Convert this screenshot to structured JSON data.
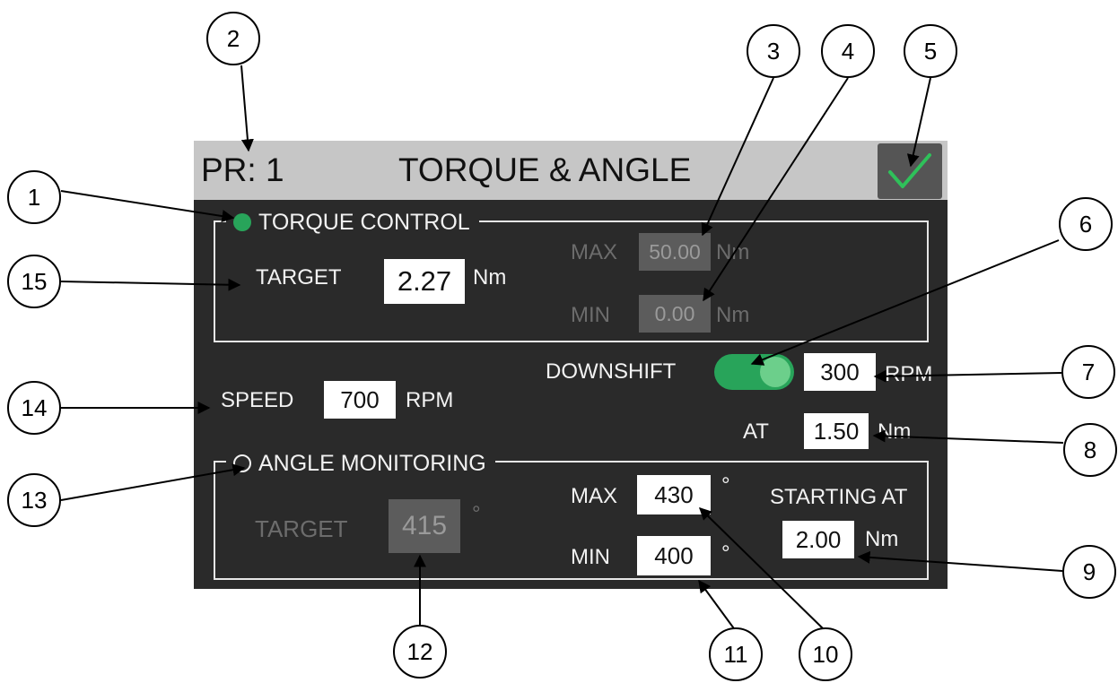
{
  "header": {
    "program_label": "PR: 1",
    "mode_title": "TORQUE & ANGLE"
  },
  "colors": {
    "panel_bg": "#2a2a2a",
    "title_bg": "#c6c6c6",
    "accent_green": "#28a45a",
    "disabled_field": "#5c5c5c"
  },
  "torque_control": {
    "label": "TORQUE CONTROL",
    "target_label": "TARGET",
    "target_value": "2.27",
    "target_unit": "Nm",
    "max_label": "MAX",
    "max_value": "50.00",
    "max_unit": "Nm",
    "min_label": "MIN",
    "min_value": "0.00",
    "min_unit": "Nm"
  },
  "speed": {
    "label": "SPEED",
    "value": "700",
    "unit": "RPM"
  },
  "downshift": {
    "label": "DOWNSHIFT",
    "enabled": true,
    "speed_value": "300",
    "speed_unit": "RPM",
    "at_label": "AT",
    "at_value": "1.50",
    "at_unit": "Nm"
  },
  "angle_monitoring": {
    "label": "ANGLE MONITORING",
    "target_label": "TARGET",
    "target_value": "415",
    "target_unit": "°",
    "max_label": "MAX",
    "max_value": "430",
    "max_unit": "°",
    "min_label": "MIN",
    "min_value": "400",
    "min_unit": "°",
    "starting_at_label": "STARTING AT",
    "starting_at_value": "2.00",
    "starting_at_unit": "Nm"
  },
  "callouts": [
    "1",
    "2",
    "3",
    "4",
    "5",
    "6",
    "7",
    "8",
    "9",
    "10",
    "11",
    "12",
    "13",
    "14",
    "15"
  ]
}
